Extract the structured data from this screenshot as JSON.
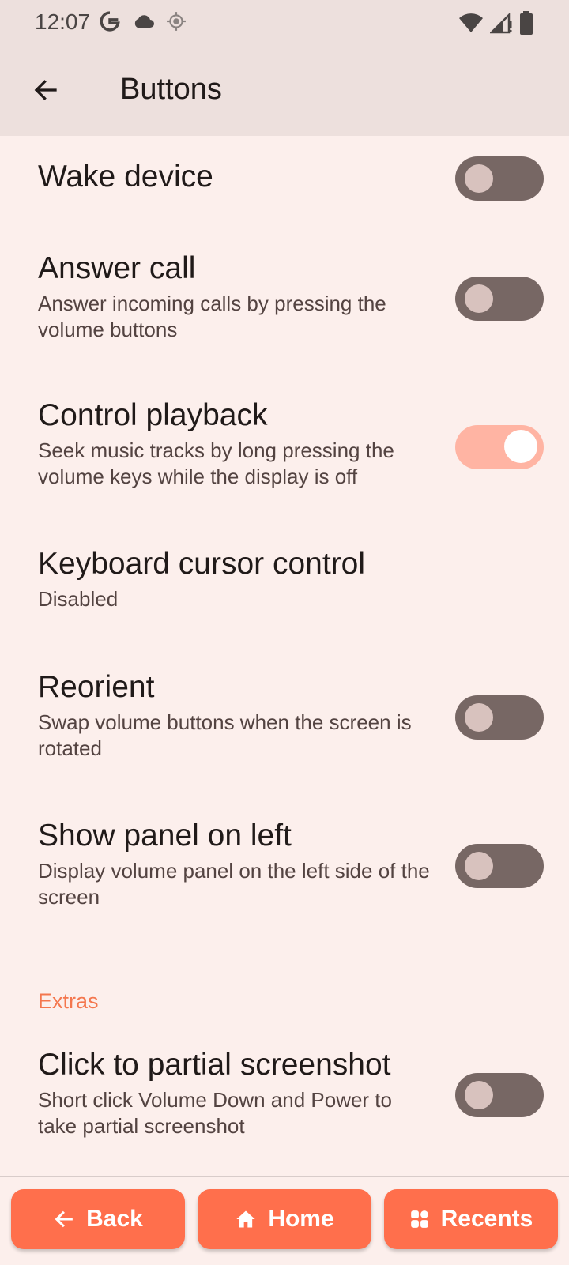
{
  "status_bar": {
    "time": "12:07",
    "left_icons": [
      "google-icon",
      "cloud-icon",
      "location-icon"
    ],
    "right_icons": [
      "wifi-icon",
      "signal-icon",
      "battery-icon"
    ]
  },
  "app_bar": {
    "title": "Buttons",
    "back_icon": "arrow-back-icon"
  },
  "settings": [
    {
      "title": "Wake device",
      "summary": "",
      "toggle": false
    },
    {
      "title": "Answer call",
      "summary": "Answer incoming calls by pressing the volume buttons",
      "toggle": false
    },
    {
      "title": "Control playback",
      "summary": "Seek music tracks by long pressing the volume keys while the display is off",
      "toggle": true
    },
    {
      "title": "Keyboard cursor control",
      "summary": "Disabled"
    },
    {
      "title": "Reorient",
      "summary": "Swap volume buttons when the screen is rotated",
      "toggle": false
    },
    {
      "title": "Show panel on left",
      "summary": "Display volume panel on the left side of the screen",
      "toggle": false
    }
  ],
  "extras": {
    "header": "Extras",
    "items": [
      {
        "title": "Click to partial screenshot",
        "summary": "Short click Volume Down and Power to take partial screenshot",
        "toggle": false
      }
    ]
  },
  "bottom_nav": {
    "back": "Back",
    "home": "Home",
    "recents": "Recents"
  },
  "colors": {
    "background": "#FCEFEC",
    "app_bar": "#EDE0DD",
    "accent": "#FF6F4C",
    "section_header": "#F4774E",
    "toggle_off_track": "#776764",
    "toggle_on_track": "#FFB4A3"
  }
}
